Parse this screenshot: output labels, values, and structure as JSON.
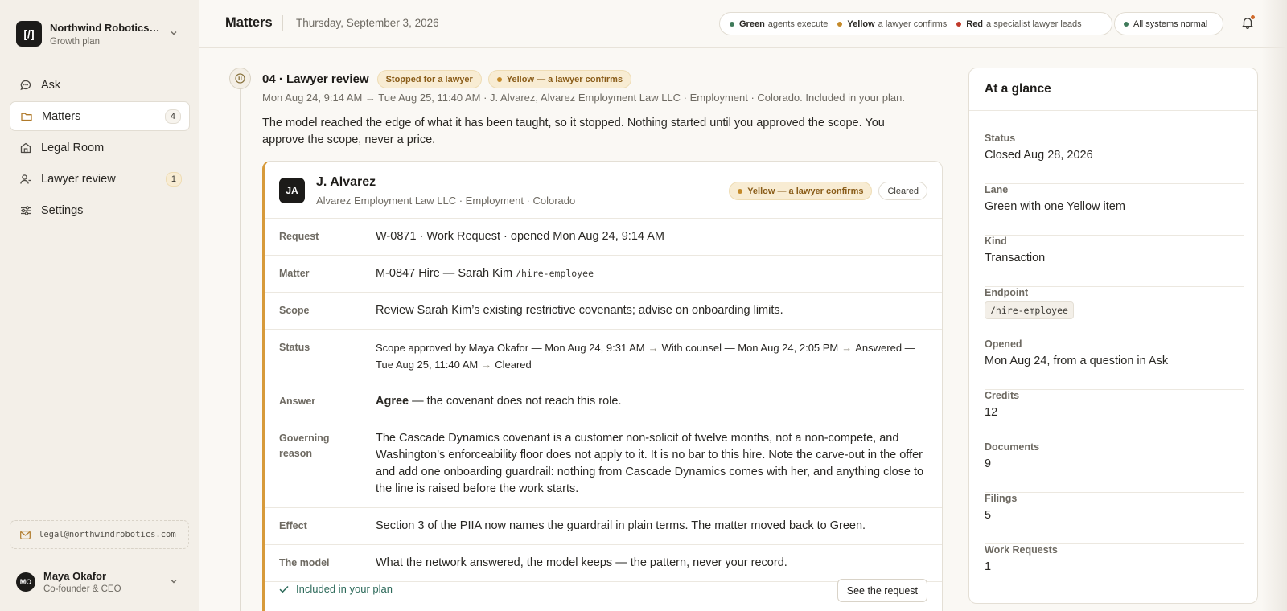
{
  "org": {
    "logo": "[/]",
    "name": "Northwind Robotics, Inc.",
    "plan": "Growth plan"
  },
  "nav": [
    {
      "label": "Ask",
      "icon": "chat-icon",
      "badge": ""
    },
    {
      "label": "Matters",
      "icon": "folder-icon",
      "badge": "4",
      "active": true
    },
    {
      "label": "Legal Room",
      "icon": "building-icon",
      "badge": ""
    },
    {
      "label": "Lawyer review",
      "icon": "person-icon",
      "badge": "1"
    },
    {
      "label": "Settings",
      "icon": "sliders-icon",
      "badge": ""
    }
  ],
  "sidebar": {
    "email": "legal@northwindrobotics.com"
  },
  "user": {
    "initials": "MO",
    "name": "Maya Okafor",
    "role": "Co-founder & CEO"
  },
  "topbar": {
    "title": "Matters",
    "date": "Thursday, September 3, 2026",
    "legend": [
      {
        "color": "#3f7a5a",
        "key": "Green",
        "text": "agents execute"
      },
      {
        "color": "#c48a2a",
        "key": "Yellow",
        "text": "a lawyer confirms"
      },
      {
        "color": "#c0392b",
        "key": "Red",
        "text": "a specialist lawyer leads"
      }
    ],
    "status": "All systems normal",
    "status_color": "#3f7a5a"
  },
  "step": {
    "title": "04 · Lawyer review",
    "tag_stop": "Stopped for a lawyer",
    "tag_yellow": "Yellow — a lawyer confirms",
    "meta": "Mon Aug 24, 9:14 AM → Tue Aug 25, 11:40 AM · J. Alvarez, Alvarez Employment Law LLC · Employment · Colorado. Included in your plan.",
    "intro": "The model reached the edge of what it has been taught, so it stopped. Nothing started until you approved the scope. You approve the scope, never a price."
  },
  "card": {
    "initials": "JA",
    "name": "J. Alvarez",
    "firm": "Alvarez Employment Law LLC · Employment · Colorado",
    "tag_yellow": "Yellow — a lawyer confirms",
    "tag_cleared": "Cleared",
    "rows": {
      "request": {
        "label": "Request",
        "value": "W-0871 · Work Request · opened Mon Aug 24, 9:14 AM"
      },
      "matter": {
        "label": "Matter",
        "value": "M-0847 Hire — Sarah Kim",
        "code": "/hire-employee"
      },
      "scope": {
        "label": "Scope",
        "value": "Review Sarah Kim’s existing restrictive covenants; advise on onboarding limits."
      },
      "status": {
        "label": "Status",
        "s1": "Scope approved by Maya Okafor — Mon Aug 24, 9:31 AM",
        "s2": "With counsel — Mon Aug 24, 2:05 PM",
        "s3": "Answered — Tue Aug 25, 11:40 AM",
        "s4": "Cleared"
      },
      "answer": {
        "label": "Answer",
        "bold": "Agree",
        "value": " — the covenant does not reach this role."
      },
      "reason": {
        "label": "Governing reason",
        "value": "The Cascade Dynamics covenant is a customer non-solicit of twelve months, not a non-compete, and Washington’s enforceability floor does not apply to it. It is no bar to this hire. Note the carve-out in the offer and add one onboarding guardrail: nothing from Cascade Dynamics comes with her, and anything close to the line is raised before the work starts."
      },
      "effect": {
        "label": "Effect",
        "value": "Section 3 of the PIIA now names the guardrail in plain terms. The matter moved back to Green."
      },
      "model": {
        "label": "The model",
        "value": "What the network answered, the model keeps — the pattern, never your record."
      }
    },
    "included": "Included in your plan",
    "button": "See the request"
  },
  "glance": {
    "title": "At a glance",
    "facts": [
      {
        "label": "Status",
        "value": "Closed Aug 28, 2026"
      },
      {
        "label": "Lane",
        "value": "Green with one Yellow item"
      },
      {
        "label": "Kind",
        "value": "Transaction"
      },
      {
        "label": "Endpoint",
        "code": "/hire-employee"
      },
      {
        "label": "Opened",
        "value": "Mon Aug 24, from a question in Ask"
      },
      {
        "label": "Credits",
        "value": "12"
      },
      {
        "label": "Documents",
        "value": "9"
      },
      {
        "label": "Filings",
        "value": "5"
      },
      {
        "label": "Work Requests",
        "value": "1"
      }
    ]
  }
}
